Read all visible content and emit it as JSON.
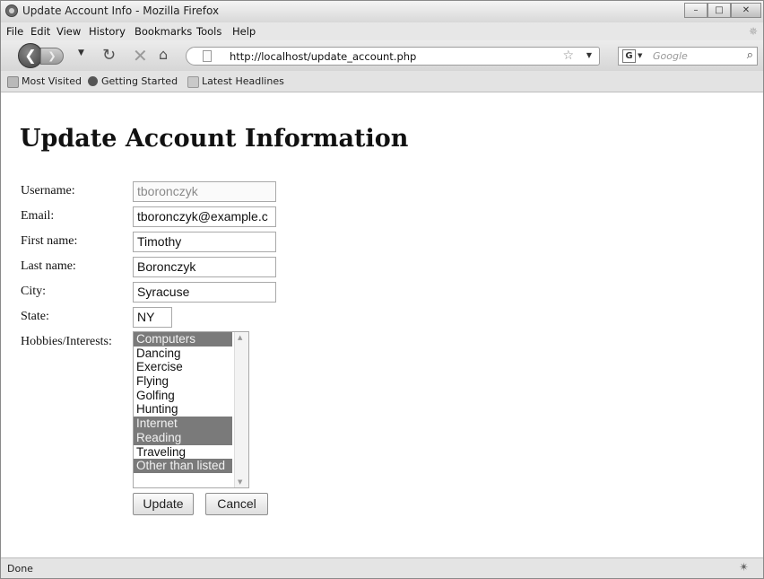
{
  "window": {
    "title": "Update Account Info - Mozilla Firefox"
  },
  "menu": {
    "items": [
      "File",
      "Edit",
      "View",
      "History",
      "Bookmarks",
      "Tools",
      "Help"
    ]
  },
  "nav": {
    "url": "http://localhost/update_account.php",
    "search_placeholder": "Google",
    "search_engine_letter": "G"
  },
  "bookmarks": {
    "items": [
      "Most Visited",
      "Getting Started",
      "Latest Headlines"
    ]
  },
  "page": {
    "title": "Update Account Information",
    "labels": {
      "username": "Username:",
      "email": "Email:",
      "first_name": "First name:",
      "last_name": "Last name:",
      "city": "City:",
      "state": "State:",
      "hobbies": "Hobbies/Interests:"
    },
    "values": {
      "username": "tboronczyk",
      "email": "tboronczyk@example.c",
      "first_name": "Timothy",
      "last_name": "Boronczyk",
      "city": "Syracuse",
      "state": "NY"
    },
    "hobbies": [
      {
        "label": "Computers",
        "selected": true
      },
      {
        "label": "Dancing",
        "selected": false
      },
      {
        "label": "Exercise",
        "selected": false
      },
      {
        "label": "Flying",
        "selected": false
      },
      {
        "label": "Golfing",
        "selected": false
      },
      {
        "label": "Hunting",
        "selected": false
      },
      {
        "label": "Internet",
        "selected": true
      },
      {
        "label": "Reading",
        "selected": true
      },
      {
        "label": "Traveling",
        "selected": false
      },
      {
        "label": "Other than listed",
        "selected": true
      }
    ],
    "buttons": {
      "update": "Update",
      "cancel": "Cancel"
    }
  },
  "status": {
    "text": "Done"
  },
  "colors": {
    "selected_option_bg": "#7a7a7a",
    "content_bg": "#ffffff"
  }
}
